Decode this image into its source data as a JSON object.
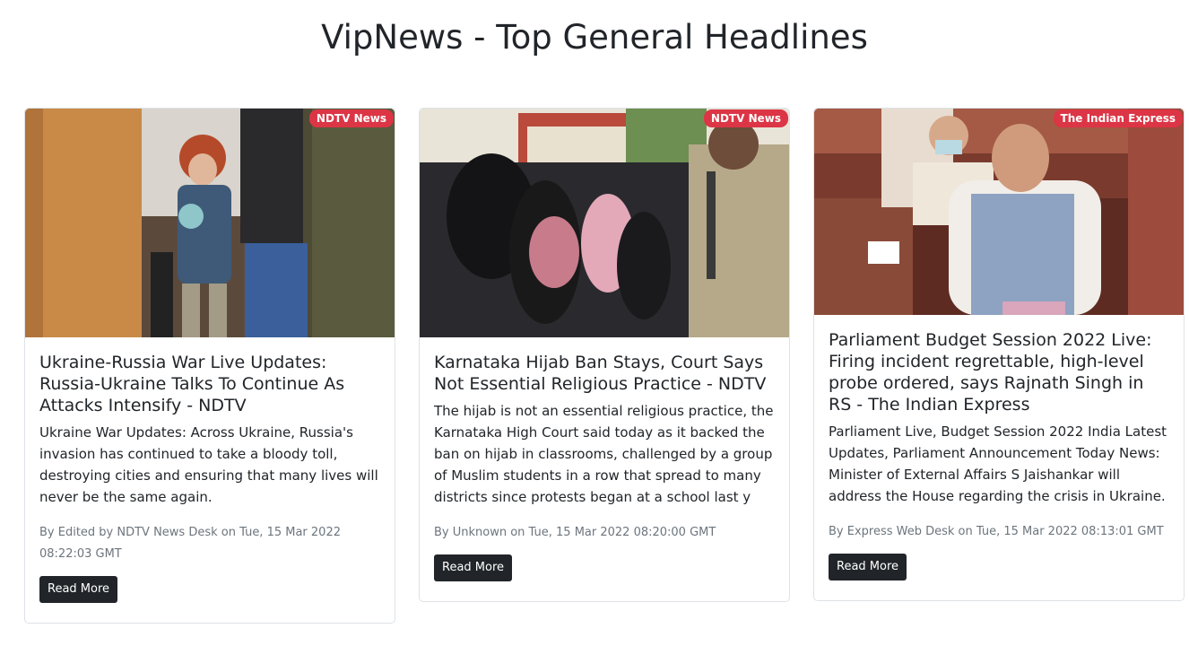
{
  "page": {
    "title": "VipNews - Top General Headlines"
  },
  "articles": [
    {
      "source": "NDTV News",
      "title": "Ukraine-Russia War Live Updates: Russia-Ukraine Talks To Continue As Attacks Intensify - NDTV",
      "description": "Ukraine War Updates: Across Ukraine, Russia's invasion has continued to take a bloody toll, destroying cities and ensuring that many lives will never be the same again.",
      "meta": "By Edited by NDTV News Desk on Tue, 15 Mar 2022 08:22:03 GMT",
      "button": "Read More"
    },
    {
      "source": "NDTV News",
      "title": "Karnataka Hijab Ban Stays, Court Says Not Essential Religious Practice - NDTV",
      "description": "The hijab is not an essential religious practice, the Karnataka High Court said today as it backed the ban on hijab in classrooms, challenged by a group of Muslim students in a row that spread to many districts since protests began at a school last y",
      "meta": "By Unknown on Tue, 15 Mar 2022 08:20:00 GMT",
      "button": "Read More"
    },
    {
      "source": "The Indian Express",
      "title": "Parliament Budget Session 2022 Live: Firing incident regrettable, high-level probe ordered, says Rajnath Singh in RS - The Indian Express",
      "description": "Parliament Live, Budget Session 2022 India Latest Updates, Parliament Announcement Today News: Minister of External Affairs S Jaishankar will address the House regarding the crisis in Ukraine.",
      "meta": "By Express Web Desk on Tue, 15 Mar 2022 08:13:01 GMT",
      "button": "Read More"
    }
  ],
  "colors": {
    "badge": "#dc3545",
    "button": "#212529",
    "meta": "#6c757d"
  }
}
